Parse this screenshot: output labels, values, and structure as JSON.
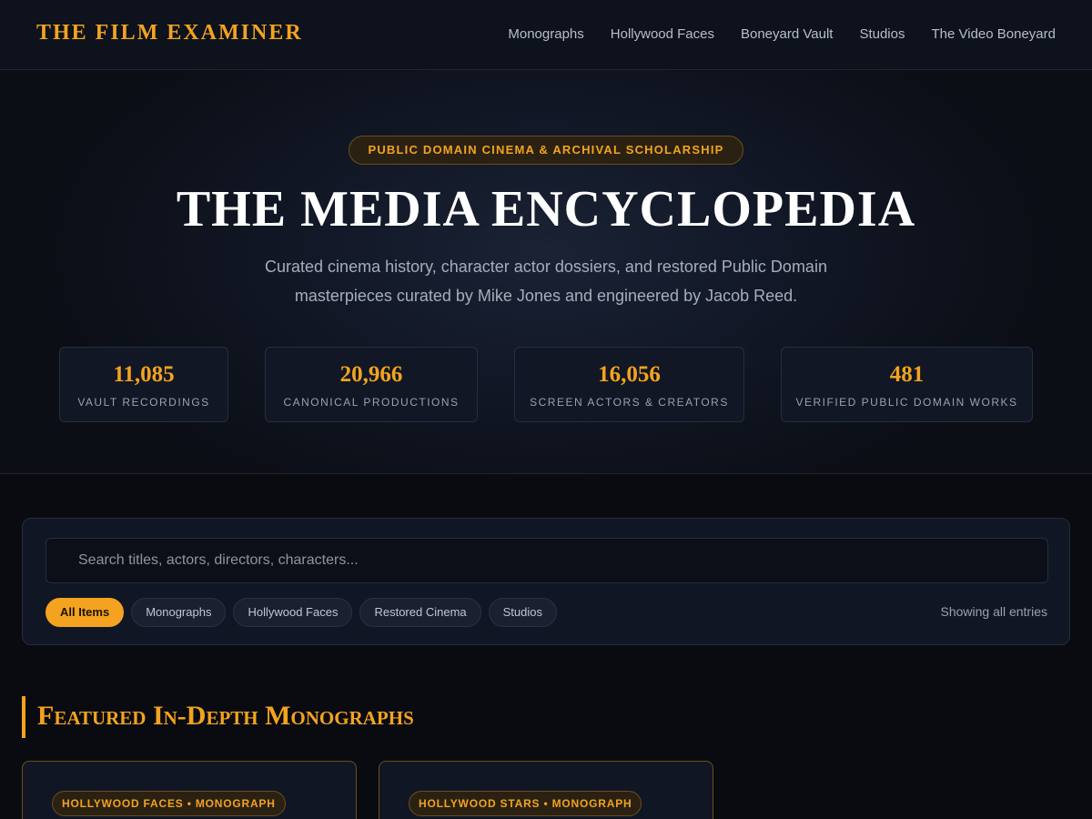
{
  "brand": {
    "name": "THE FILM EXAMINER",
    "accent_color": "#f3a31f"
  },
  "nav": {
    "items": [
      {
        "label": "Monographs"
      },
      {
        "label": "Hollywood Faces"
      },
      {
        "label": "Boneyard Vault"
      },
      {
        "label": "Studios"
      },
      {
        "label": "The Video Boneyard"
      }
    ]
  },
  "hero": {
    "eyebrow": "PUBLIC DOMAIN CINEMA & ARCHIVAL SCHOLARSHIP",
    "title": "THE MEDIA ENCYCLOPEDIA",
    "subtitle": "Curated cinema history, character actor dossiers, and restored Public Domain masterpieces curated by Mike Jones and engineered by Jacob Reed.",
    "stats": [
      {
        "value": "11,085",
        "label": "VAULT RECORDINGS"
      },
      {
        "value": "20,966",
        "label": "CANONICAL PRODUCTIONS"
      },
      {
        "value": "16,056",
        "label": "SCREEN ACTORS & CREATORS"
      },
      {
        "value": "481",
        "label": "VERIFIED PUBLIC DOMAIN WORKS"
      }
    ]
  },
  "search": {
    "placeholder": "Search titles, actors, directors, characters...",
    "value": "",
    "filters": [
      {
        "label": "All Items",
        "active": true
      },
      {
        "label": "Monographs",
        "active": false
      },
      {
        "label": "Hollywood Faces",
        "active": false
      },
      {
        "label": "Restored Cinema",
        "active": false
      },
      {
        "label": "Studios",
        "active": false
      }
    ],
    "status": "Showing all entries"
  },
  "featured": {
    "title": "Featured In-Depth Monographs",
    "cards": [
      {
        "tag": "HOLLYWOOD FACES • MONOGRAPH"
      },
      {
        "tag": "HOLLYWOOD STARS • MONOGRAPH"
      }
    ]
  }
}
